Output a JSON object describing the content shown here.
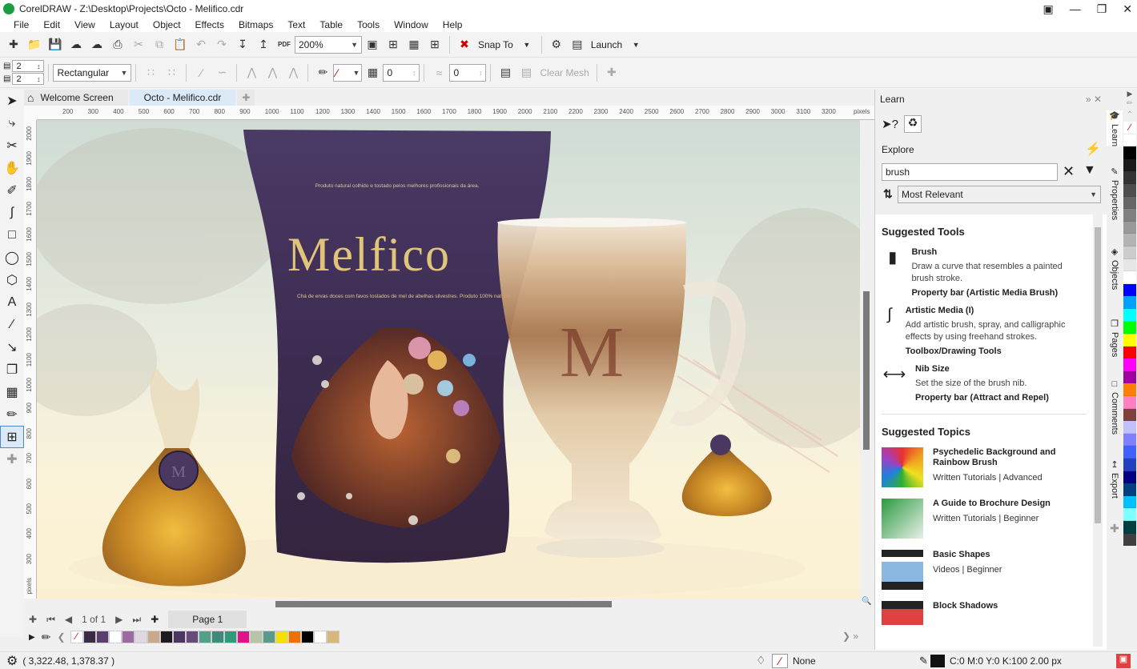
{
  "window": {
    "title": "CorelDRAW - Z:\\Desktop\\Projects\\Octo - Melifico.cdr"
  },
  "menu": [
    "File",
    "Edit",
    "View",
    "Layout",
    "Object",
    "Effects",
    "Bitmaps",
    "Text",
    "Table",
    "Tools",
    "Window",
    "Help"
  ],
  "standard_toolbar": {
    "zoom": "200%",
    "snap_to": "Snap To",
    "launch": "Launch",
    "pdf_label": "PDF"
  },
  "property_bar": {
    "rows": "2",
    "cols": "2",
    "mesh_type": "Rectangular",
    "transparency": "0",
    "smoothing": "0",
    "clear_mesh": "Clear Mesh"
  },
  "doc_tabs": [
    {
      "label": "Welcome Screen"
    },
    {
      "label": "Octo - Melifico.cdr"
    }
  ],
  "ruler": {
    "h_ticks": [
      "200",
      "300",
      "400",
      "500",
      "600",
      "700",
      "800",
      "900",
      "1000",
      "1100",
      "1200",
      "1300",
      "1400",
      "1500",
      "1600",
      "1700",
      "1800",
      "1900",
      "2000",
      "2100",
      "2200",
      "2300",
      "2400",
      "2500",
      "2600",
      "2700",
      "2800",
      "2900",
      "3000",
      "3100",
      "3200"
    ],
    "h_unit": "pixels",
    "v_ticks": [
      "2000",
      "1900",
      "1800",
      "1700",
      "1600",
      "1500",
      "1400",
      "1300",
      "1200",
      "1100",
      "1000",
      "900",
      "800",
      "700",
      "600",
      "500",
      "400",
      "300"
    ],
    "v_unit": "pixels"
  },
  "artwork": {
    "brand": "Melfico",
    "tagline": "Produto natural colhido e tostado pelos melhores profissionais da área.",
    "description": "Chá de ervas doces com favos tostados de mel de abelhas silvestres. Produto 100% natural."
  },
  "page_nav": {
    "page_info": "1 of 1",
    "page_tab": "Page 1"
  },
  "doc_palette": [
    "#3a2a44",
    "#5b3f6e",
    "#ffffff",
    "#9a6aa0",
    "#e0d7e3",
    "#c9a98a",
    "#1e1a22",
    "#4a3660",
    "#6a4a78",
    "#52a08a",
    "#3f8a7a",
    "#2e9a7a",
    "#e0148a",
    "#b8c4a8",
    "#5a9a88",
    "#f5e000",
    "#f07000",
    "#000000",
    "#ffffff",
    "#d8b878"
  ],
  "learn_panel": {
    "title": "Learn",
    "explore_label": "Explore",
    "search_value": "brush",
    "sort": "Most Relevant",
    "suggested_tools_title": "Suggested Tools",
    "tools": [
      {
        "name": "Brush",
        "desc": "Draw a curve that resembles a painted brush stroke.",
        "link": "Property bar (Artistic Media Brush)"
      },
      {
        "name": "Artistic Media (I)",
        "desc": "Add artistic brush, spray, and calligraphic effects by using freehand strokes.",
        "link": "Toolbox/Drawing Tools"
      },
      {
        "name": "Nib Size",
        "desc": "Set the size of the brush nib.",
        "link": "Property bar (Attract and Repel)"
      }
    ],
    "suggested_topics_title": "Suggested Topics",
    "topics": [
      {
        "title": "Psychedelic Background and Rainbow Brush",
        "type": "Written Tutorials",
        "level": "Advanced"
      },
      {
        "title": "A Guide to Brochure Design",
        "type": "Written Tutorials",
        "level": "Beginner"
      },
      {
        "title": "Basic Shapes",
        "type": "Videos",
        "level": "Beginner"
      },
      {
        "title": "Block Shadows",
        "type": "",
        "level": ""
      }
    ]
  },
  "side_tabs": [
    "Learn",
    "Properties",
    "Objects",
    "Pages",
    "Comments",
    "Export"
  ],
  "color_palette": [
    "#ffffff",
    "#000000",
    "#1a1a1a",
    "#333333",
    "#4d4d4d",
    "#666666",
    "#808080",
    "#999999",
    "#b3b3b3",
    "#cccccc",
    "#e6e6e6",
    "#ffffff",
    "#0000ff",
    "#00a0ff",
    "#00ffff",
    "#00ff00",
    "#ffff00",
    "#ff0000",
    "#ff00ff",
    "#a000a0",
    "#ff8000",
    "#ff80c0",
    "#804040",
    "#c0c0ff",
    "#8080ff",
    "#4060ff",
    "#2040c0",
    "#000080",
    "#004080",
    "#00c0ff",
    "#80ffff",
    "#004040",
    "#404040"
  ],
  "status": {
    "coords": "( 3,322.48, 1,378.37 )",
    "fill": "None",
    "outline": "C:0 M:0 Y:0 K:100  2.00 px"
  }
}
